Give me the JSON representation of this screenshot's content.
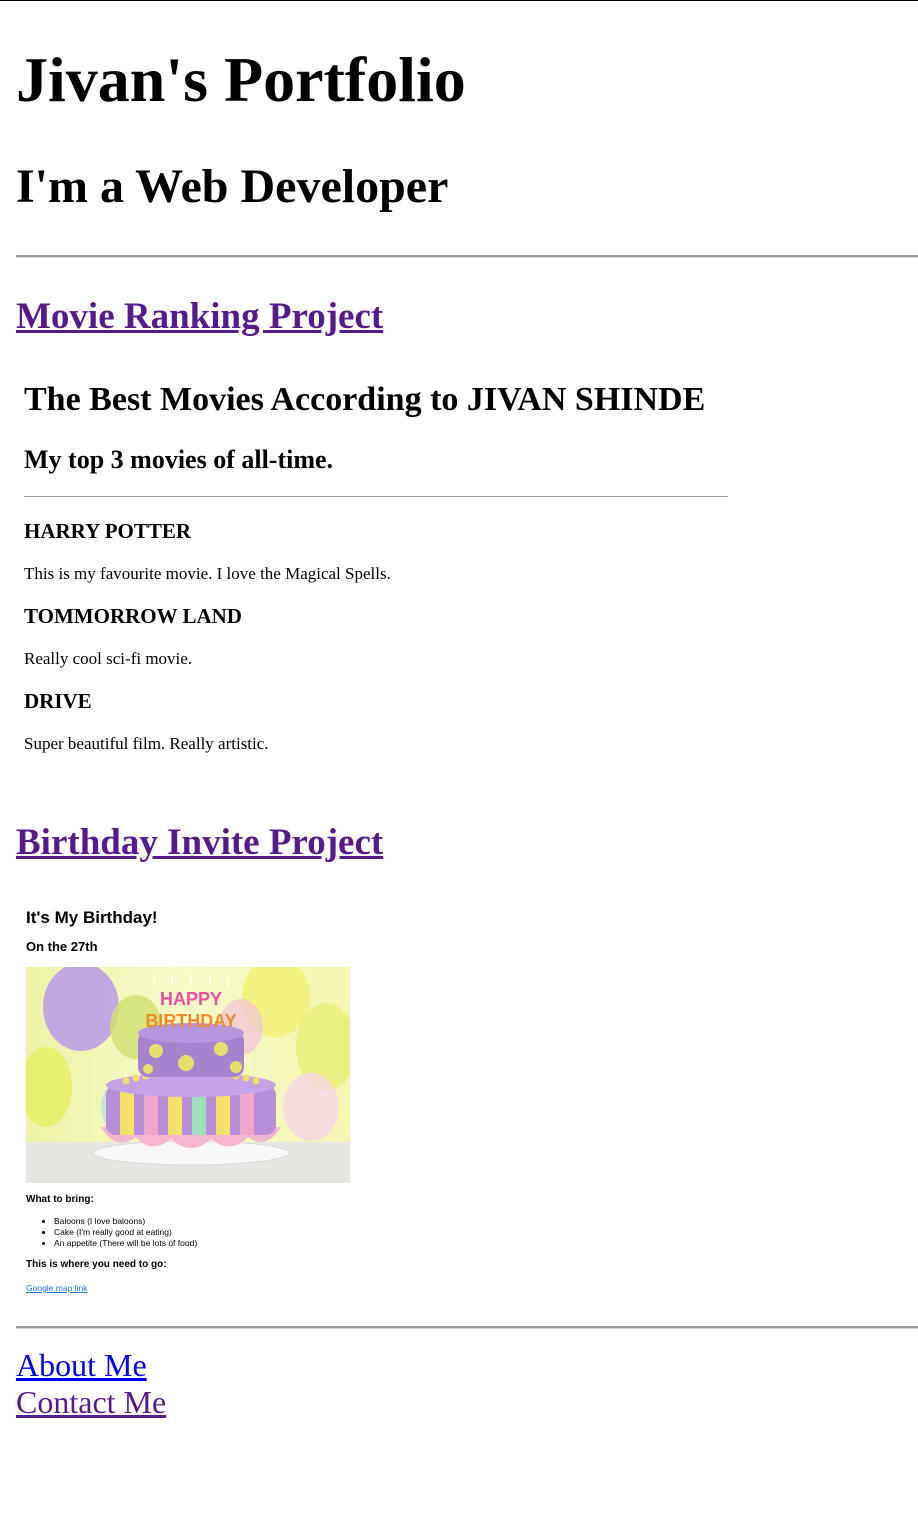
{
  "header": {
    "title": "Jivan's Portfolio",
    "subtitle": "I'm a Web Developer"
  },
  "projects": {
    "movie": {
      "link_label": "Movie Ranking Project",
      "heading": "The Best Movies According to JIVAN SHINDE",
      "subheading": "My top 3 movies of all-time.",
      "movies": [
        {
          "title": "HARRY POTTER",
          "description": "This is my favourite movie. I love the Magical Spells."
        },
        {
          "title": "TOMMORROW LAND",
          "description": "Really cool sci-fi movie."
        },
        {
          "title": "DRIVE",
          "description": "Super beautiful film. Really artistic."
        }
      ]
    },
    "birthday": {
      "link_label": "Birthday Invite Project",
      "heading": "It's My Birthday!",
      "date": "On the 27th",
      "cake_topper": [
        "HAPPY",
        "BIRTHDAY"
      ],
      "bring_heading": "What to bring:",
      "bring_items": [
        "Baloons (I love baloons)",
        "Cake (I'm really good at eating)",
        "An appetite (There will be lots of food)"
      ],
      "where_heading": "This is where you need to go:",
      "map_link": "Google map link"
    }
  },
  "footer": {
    "about": "About Me",
    "contact": "Contact Me"
  },
  "colors": {
    "visited_link": "#551a8b",
    "unvisited_link": "#0000ee",
    "map_link": "#1a73e8"
  }
}
